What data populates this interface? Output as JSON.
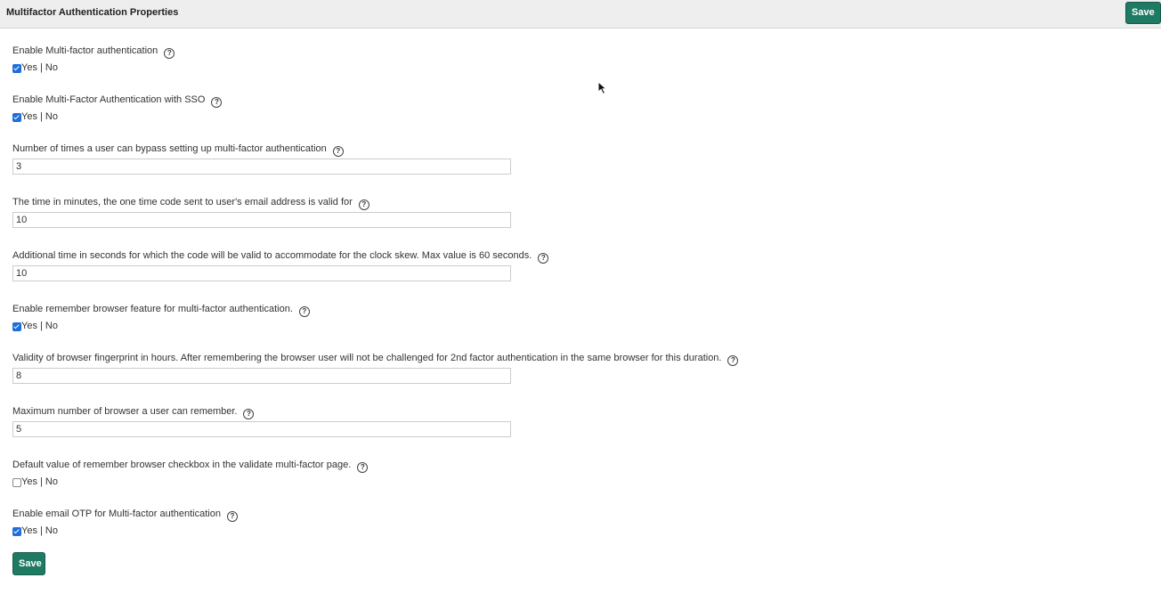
{
  "header": {
    "title": "Multifactor Authentication Properties",
    "save_label": "Save"
  },
  "yes_no_label": "Yes | No",
  "help_glyph": "?",
  "fields": {
    "enable_mfa": {
      "label": "Enable Multi-factor authentication",
      "checked": true
    },
    "enable_mfa_sso": {
      "label": "Enable Multi-Factor Authentication with SSO",
      "checked": true
    },
    "bypass_count": {
      "label": "Number of times a user can bypass setting up multi-factor authentication",
      "value": "3"
    },
    "otp_validity": {
      "label": "The time in minutes, the one time code sent to user's email address is valid for",
      "value": "10"
    },
    "clock_skew": {
      "label": "Additional time in seconds for which the code will be valid to accommodate for the clock skew. Max value is 60 seconds.",
      "value": "10"
    },
    "remember_browser": {
      "label": "Enable remember browser feature for multi-factor authentication.",
      "checked": true
    },
    "fingerprint_validity": {
      "label": "Validity of browser fingerprint in hours. After remembering the browser user will not be challenged for 2nd factor authentication in the same browser for this duration.",
      "value": "8"
    },
    "max_browsers": {
      "label": "Maximum number of browser a user can remember.",
      "value": "5"
    },
    "default_remember": {
      "label": "Default value of remember browser checkbox in the validate multi-factor page.",
      "checked": false
    },
    "email_otp": {
      "label": "Enable email OTP for Multi-factor authentication",
      "checked": true
    }
  },
  "footer": {
    "save_label": "Save"
  }
}
